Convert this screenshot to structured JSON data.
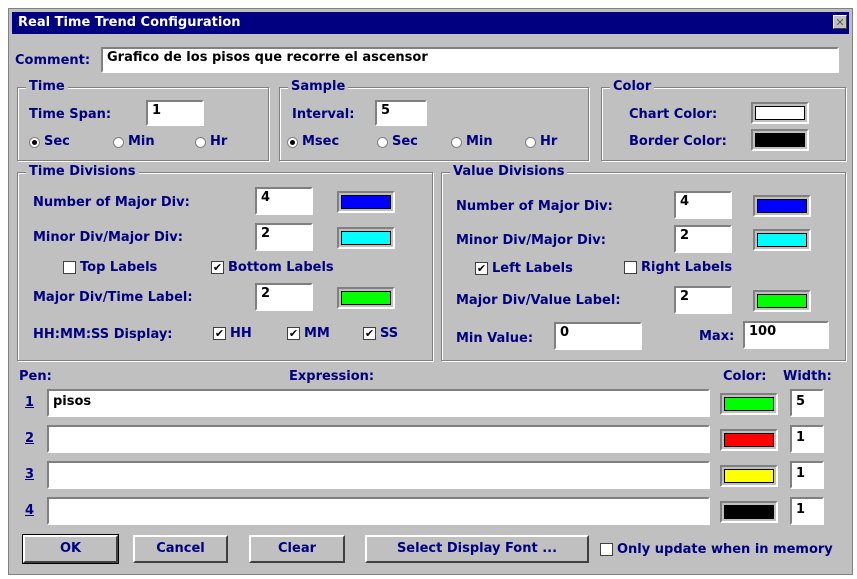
{
  "window": {
    "title": "Real Time Trend Configuration",
    "close_glyph": "✕"
  },
  "comment": {
    "label": "Comment:",
    "value": "Grafico de los pisos que recorre el ascensor"
  },
  "time": {
    "title": "Time",
    "span_label": "Time Span:",
    "span_value": "1",
    "units": [
      "Sec",
      "Min",
      "Hr"
    ],
    "selected": "Sec"
  },
  "sample": {
    "title": "Sample",
    "interval_label": "Interval:",
    "interval_value": "5",
    "units": [
      "Msec",
      "Sec",
      "Min",
      "Hr"
    ],
    "selected": "Msec"
  },
  "color": {
    "title": "Color",
    "chart_label": "Chart Color:",
    "chart_color": "#ffffff",
    "border_label": "Border Color:",
    "border_color": "#000000"
  },
  "time_div": {
    "title": "Time Divisions",
    "major_label": "Number of Major Div:",
    "major_value": "4",
    "major_color": "#0000ff",
    "minor_label": "Minor Div/Major Div:",
    "minor_value": "2",
    "minor_color": "#00ffff",
    "top_labels": "Top Labels",
    "top_checked": false,
    "bottom_labels": "Bottom Labels",
    "bottom_checked": true,
    "label_label": "Major Div/Time Label:",
    "label_value": "2",
    "label_color": "#00ff00",
    "hms_label": "HH:MM:SS Display:",
    "hh": "HH",
    "mm": "MM",
    "ss": "SS"
  },
  "value_div": {
    "title": "Value Divisions",
    "major_label": "Number of Major Div:",
    "major_value": "4",
    "major_color": "#0000ff",
    "minor_label": "Minor Div/Major Div:",
    "minor_value": "2",
    "minor_color": "#00ffff",
    "left_labels": "Left Labels",
    "left_checked": true,
    "right_labels": "Right Labels",
    "right_checked": false,
    "label_label": "Major Div/Value Label:",
    "label_value": "2",
    "label_color": "#00ff00",
    "min_label": "Min Value:",
    "min_value": "0",
    "max_label": "Max:",
    "max_value": "100"
  },
  "pens": {
    "pen_header": "Pen:",
    "expr_header": "Expression:",
    "color_header": "Color:",
    "width_header": "Width:",
    "rows": [
      {
        "num": "1",
        "expr": "pisos",
        "color": "#00ff00",
        "width": "5"
      },
      {
        "num": "2",
        "expr": "",
        "color": "#ff0000",
        "width": "1"
      },
      {
        "num": "3",
        "expr": "",
        "color": "#ffff00",
        "width": "1"
      },
      {
        "num": "4",
        "expr": "",
        "color": "#000000",
        "width": "1"
      }
    ]
  },
  "buttons": {
    "ok": "OK",
    "cancel": "Cancel",
    "clear": "Clear",
    "font": "Select Display Font ..."
  },
  "memory": {
    "label": "Only update when in memory",
    "checked": false
  },
  "check_glyph": "✔"
}
